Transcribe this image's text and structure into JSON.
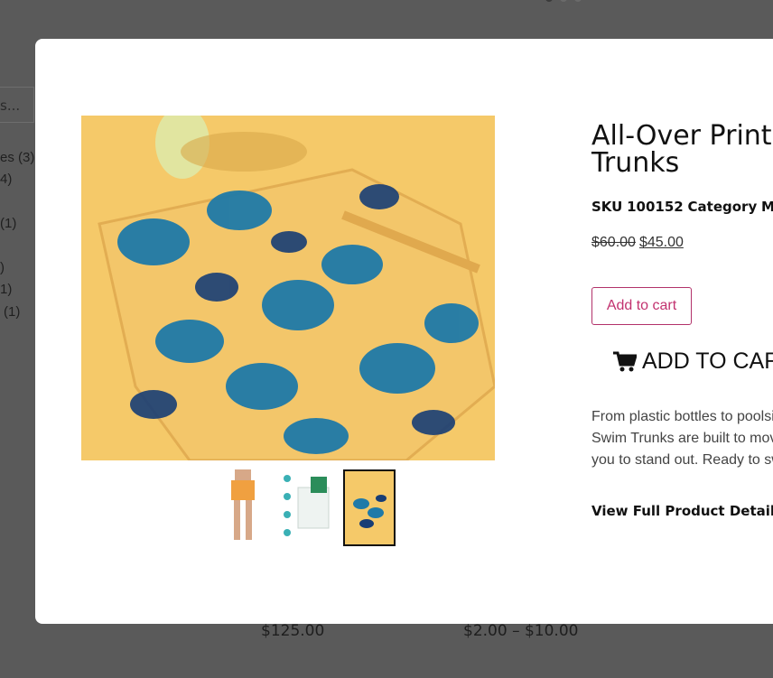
{
  "background": {
    "search_text": "s...",
    "categories": [
      "es (3)",
      "4)",
      "(1)",
      ")",
      "1)",
      "(1)"
    ],
    "prices": [
      "$125.00",
      "$2.00 – $10.00"
    ]
  },
  "product": {
    "title_line1": "All-Over Print",
    "title_line2": "Trunks",
    "sku_label": "SKU",
    "sku_value": "100152",
    "category_label": "Category",
    "category_value": "Men's",
    "old_price": "$60.00",
    "new_price": "$45.00",
    "add_to_cart_small": "Add to cart",
    "add_to_cart_big": "ADD TO CAR",
    "description_lines": [
      "From plastic bottles to poolsi",
      "Swim Trunks are built to mov",
      "you to stand out. Ready to sw"
    ],
    "view_details": "View Full Product Details"
  },
  "colors": {
    "accent": "#c2326f",
    "image_bg": "#f5c969",
    "leaf_blue": "#1f7aa8"
  },
  "icons": [
    "cart-icon"
  ]
}
